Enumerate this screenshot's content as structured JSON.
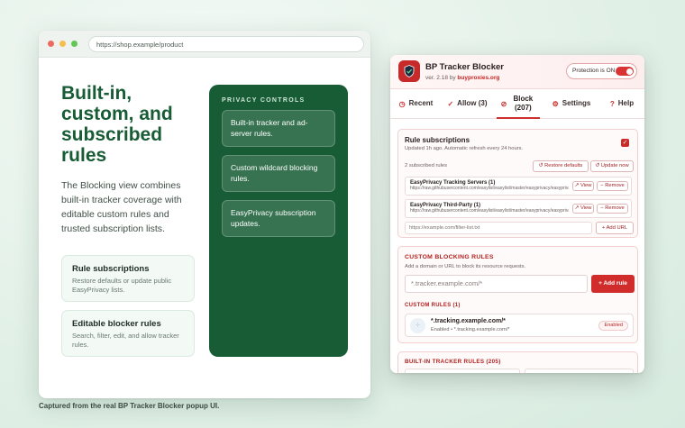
{
  "browser": {
    "url": "https://shop.example/product",
    "dots": [
      "#ee6a5f",
      "#f5be4f",
      "#62c554"
    ]
  },
  "hero": {
    "title": "Built-in, custom, and subscribed rules",
    "description": "The Blocking view combines built-in tracker coverage with editable custom rules and trusted subscription lists."
  },
  "feature_cards": [
    {
      "title": "Rule subscriptions",
      "desc": "Restore defaults or update public EasyPrivacy lists."
    },
    {
      "title": "Editable blocker rules",
      "desc": "Search, filter, edit, and allow tracker rules."
    }
  ],
  "privacy_panel": {
    "heading": "PRIVACY CONTROLS",
    "items": [
      "Built-in tracker and ad-server rules.",
      "Custom wildcard blocking rules.",
      "EasyPrivacy subscription updates."
    ]
  },
  "caption": "Captured from the real BP Tracker Blocker popup UI.",
  "popup": {
    "app_name": "BP Tracker Blocker",
    "version_prefix": "ver. 2.18 by",
    "version_link": "buyproxies.org",
    "protection_label": "Protection is ON",
    "tabs": [
      {
        "icon": "clock-icon",
        "glyph": "◷",
        "label": "Recent"
      },
      {
        "icon": "check-icon",
        "glyph": "✓",
        "label": "Allow (3)"
      },
      {
        "icon": "block-icon",
        "glyph": "⊘",
        "label": "Block (207)"
      },
      {
        "icon": "gear-icon",
        "glyph": "⚙",
        "label": "Settings"
      },
      {
        "icon": "help-icon",
        "glyph": "?",
        "label": "Help"
      }
    ],
    "subscriptions": {
      "title": "Rule subscriptions",
      "updated": "Updated 1h ago. Automatic refresh every 24 hours.",
      "count_label": "2 subscribed rules",
      "restore_label": "↺ Restore defaults",
      "update_label": "↺ Update now",
      "items": [
        {
          "name": "EasyPrivacy Tracking Servers (1)",
          "url": "https://raw.githubusercontent.com/easylist/easylist/master/easyprivacy/easyprivacy_trackingservers.txt"
        },
        {
          "name": "EasyPrivacy Third-Party (1)",
          "url": "https://raw.githubusercontent.com/easylist/easylist/master/easyprivacy/easyprivacy_thirdparty.txt"
        }
      ],
      "view_label": "↗ View",
      "remove_label": "− Remove",
      "url_placeholder": "https://example.com/filter-list.txt",
      "add_url_label": "+ Add URL"
    },
    "custom": {
      "heading": "CUSTOM BLOCKING RULES",
      "desc": "Add a domain or URL to block its resource requests.",
      "input_placeholder": "*.tracker.example.com/*",
      "add_rule_label": "+ Add rule",
      "list_heading": "CUSTOM RULES (1)",
      "rule_pattern": "*.tracking.example.com/*",
      "rule_meta": "Enabled • *.tracking.example.com/*",
      "rule_status": "Enabled"
    },
    "builtin_heading": "BUILT-IN TRACKER RULES (205)"
  },
  "colors": {
    "brand_green": "#175c35",
    "brand_red": "#c92b2b"
  }
}
